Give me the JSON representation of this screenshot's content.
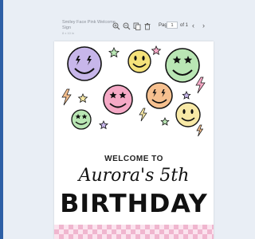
{
  "document": {
    "title": "Smiley Face Pink Welcome Sign",
    "size": "8 x 10 in"
  },
  "toolbar": {
    "icons": [
      "zoom-in-icon",
      "zoom-out-icon",
      "copy-icon",
      "trash-icon"
    ],
    "page_label": "Page",
    "page_value": "1",
    "page_of": "of 1",
    "prev": "‹",
    "next": "›"
  },
  "sign": {
    "welcome": "WELCOME TO",
    "name_line": "Aurora's 5th",
    "headline": "BIRTHDAY"
  },
  "colors": {
    "accent": "#2d5fa6",
    "smiley_purple": "#c7b6ea",
    "smiley_yellow": "#f5e27a",
    "smiley_green": "#b9e6b4",
    "smiley_pink": "#f5a9c6",
    "smiley_orange": "#f6c08f",
    "smiley_light_yellow": "#f8e9a6",
    "checker_pink": "#f0b6cf"
  }
}
